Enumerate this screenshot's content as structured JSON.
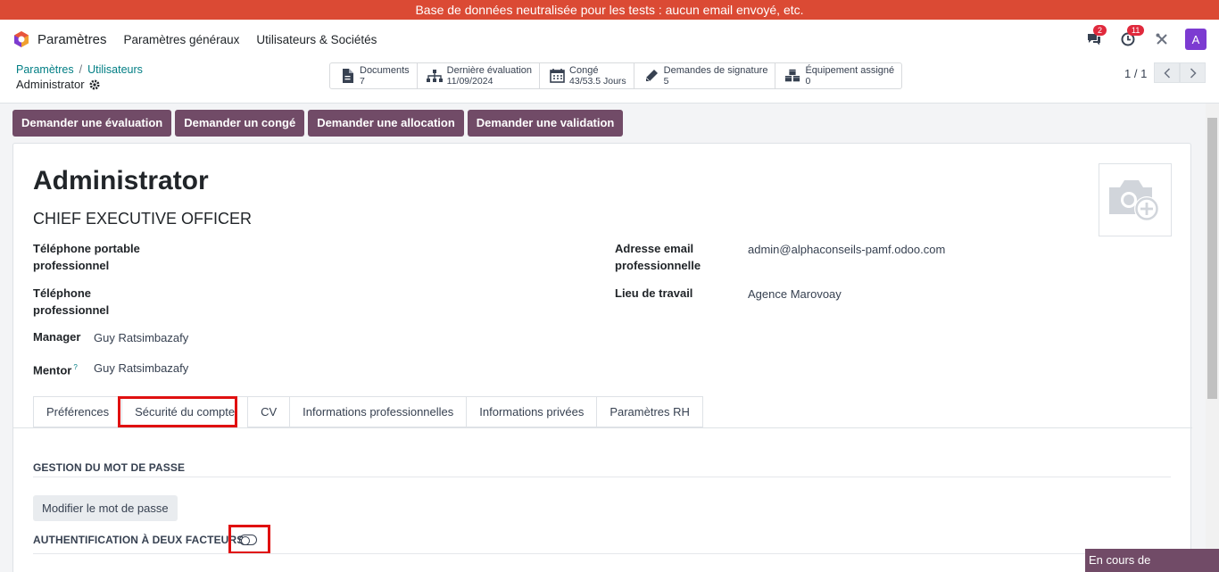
{
  "banner": "Base de données neutralisée pour les tests : aucun email envoyé, etc.",
  "navbar": {
    "app_name": "Paramètres",
    "menu": [
      "Paramètres généraux",
      "Utilisateurs & Sociétés"
    ],
    "messages_badge": "2",
    "activities_badge": "11",
    "avatar_letter": "A"
  },
  "breadcrumb": {
    "items": [
      "Paramètres",
      "Utilisateurs"
    ],
    "current": "Administrator"
  },
  "smart_buttons": [
    {
      "label": "Documents",
      "value": "7",
      "icon": "file-icon"
    },
    {
      "label": "Dernière évaluation",
      "value": "11/09/2024",
      "icon": "sitemap-icon"
    },
    {
      "label": "Congé",
      "value": "43/53.5 Jours",
      "icon": "calendar-icon"
    },
    {
      "label": "Demandes de signature",
      "value": "5",
      "icon": "pencil-icon"
    },
    {
      "label": "Équipement assigné",
      "value": "0",
      "icon": "cubes-icon"
    }
  ],
  "pager": {
    "value": "1 / 1"
  },
  "actions": [
    "Demander une évaluation",
    "Demander un congé",
    "Demander une allocation",
    "Demander une validation"
  ],
  "employee": {
    "name": "Administrator",
    "job_title": "CHIEF EXECUTIVE OFFICER",
    "fields": {
      "mobile_label_1": "Téléphone portable",
      "mobile_label_2": "professionnel",
      "phone_label_1": "Téléphone",
      "phone_label_2": "professionnel",
      "manager_label": "Manager",
      "manager_value": "Guy Ratsimbazafy",
      "mentor_label": "Mentor",
      "mentor_help": "?",
      "mentor_value": "Guy Ratsimbazafy",
      "email_label_1": "Adresse email",
      "email_label_2": "professionnelle",
      "email_value": "admin@alphaconseils-pamf.odoo.com",
      "workplace_label": "Lieu de travail",
      "workplace_value": "Agence Marovoay"
    }
  },
  "tabs": [
    "Préférences",
    "Sécurité du compte",
    "CV",
    "Informations professionnelles",
    "Informations privées",
    "Paramètres RH"
  ],
  "active_tab": "Sécurité du compte",
  "security": {
    "password_section": "GESTION DU MOT DE PASSE",
    "change_password": "Modifier le mot de passe",
    "twofa_label": "AUTHENTIFICATION À DEUX FACTEURS",
    "twofa_enabled": false
  },
  "loading": "En cours de chargement...",
  "colors": {
    "banner": "#db4a34",
    "primary": "#714b67",
    "link": "#017e84",
    "highlight": "#e01010"
  }
}
